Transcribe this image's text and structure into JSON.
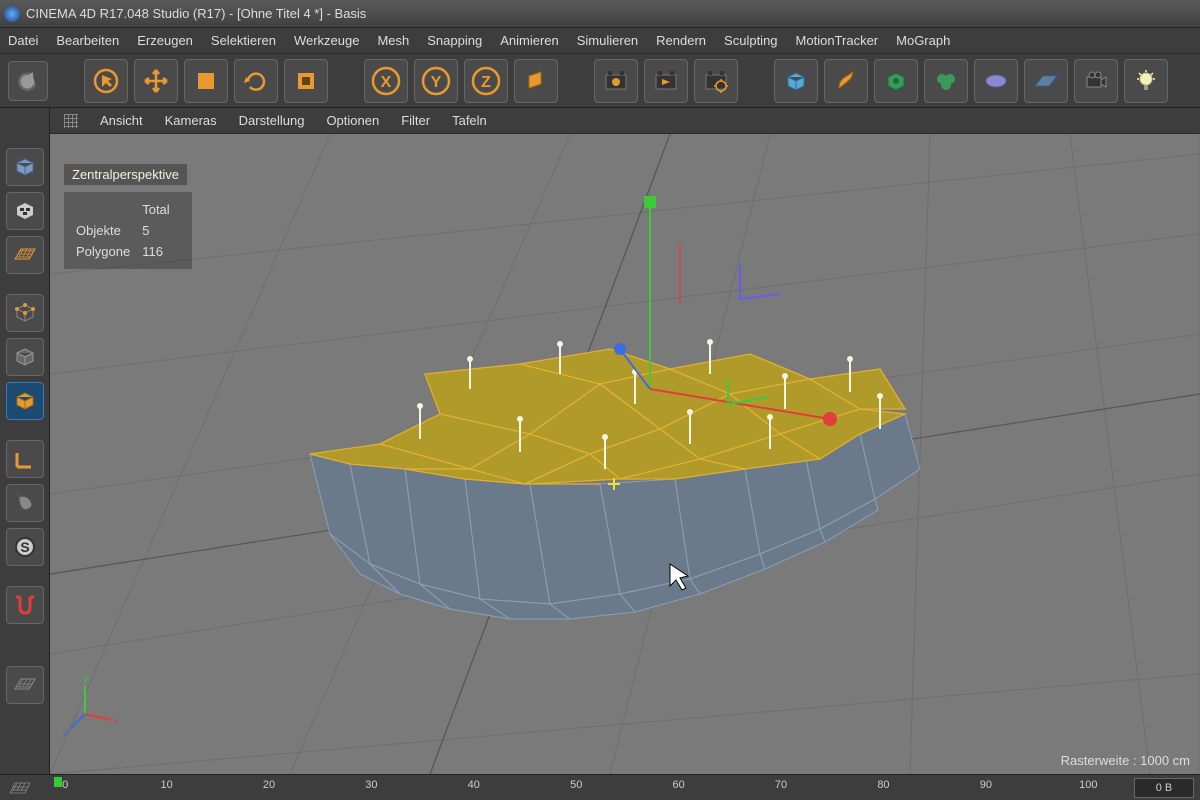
{
  "title": "CINEMA 4D R17.048 Studio (R17) - [Ohne Titel 4 *] - Basis",
  "menu": [
    "Datei",
    "Bearbeiten",
    "Erzeugen",
    "Selektieren",
    "Werkzeuge",
    "Mesh",
    "Snapping",
    "Animieren",
    "Simulieren",
    "Rendern",
    "Sculpting",
    "MotionTracker",
    "MoGraph"
  ],
  "view_menu": [
    "Ansicht",
    "Kameras",
    "Darstellung",
    "Optionen",
    "Filter",
    "Tafeln"
  ],
  "viewport": {
    "label": "Zentralperspektive",
    "stats": {
      "totalHeader": "Total",
      "rows": [
        [
          "Objekte",
          "5"
        ],
        [
          "Polygone",
          "116"
        ]
      ]
    },
    "rasterweite_text": "Rasterweite : 1000 cm"
  },
  "toolbar_icons": [
    "undo",
    "select-arrow",
    "move",
    "cube",
    "rotate",
    "cube-poly",
    "axis-x",
    "axis-y",
    "axis-z",
    "global-axis",
    "render-anim",
    "render-queue",
    "render-region",
    "cube-prim",
    "pen",
    "deformer-1",
    "deformer-2",
    "deformer-3",
    "floor",
    "camera",
    "light"
  ],
  "left_tools": [
    "cube-solid",
    "cube-checker",
    "grid",
    "cube-points",
    "cube-wire",
    "cube-poly",
    "edge-l",
    "mouse",
    "circle-s",
    "magnet",
    "grid-bottom"
  ],
  "timeline": {
    "start": 0,
    "marks": [
      0,
      10,
      20,
      30,
      40,
      50,
      60,
      70,
      80,
      90,
      100
    ],
    "status": "0 B"
  },
  "colors": {
    "accent": "#e89a2e",
    "axis_x": "#e23c3c",
    "axis_y": "#3cc93c",
    "axis_z": "#3c6ce2"
  }
}
